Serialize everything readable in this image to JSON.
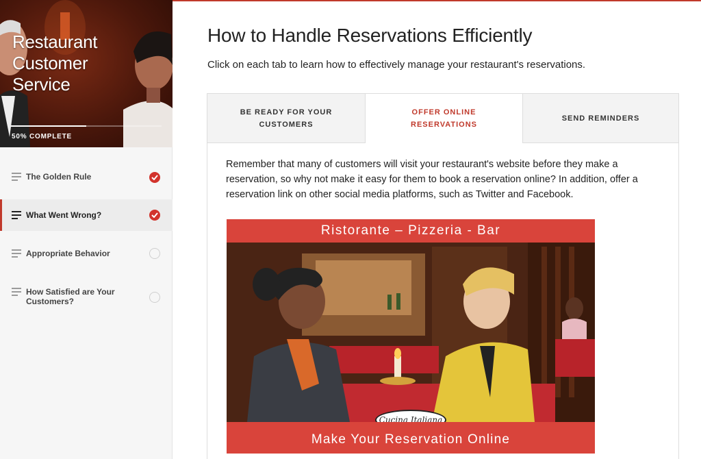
{
  "course": {
    "title": "Restaurant Customer Service",
    "progress_label": "50% COMPLETE",
    "progress_fraction": 0.5
  },
  "lessons": [
    {
      "label": "The Golden Rule",
      "status": "complete",
      "active": false,
      "icon": "lines-icon"
    },
    {
      "label": "What Went Wrong?",
      "status": "complete",
      "active": true,
      "icon": "lines-icon"
    },
    {
      "label": "Appropriate Behavior",
      "status": "incomplete",
      "active": false,
      "icon": "lines-icon"
    },
    {
      "label": "How Satisfied are Your Customers?",
      "status": "incomplete",
      "active": false,
      "icon": "lines-icon"
    }
  ],
  "page": {
    "title": "How to Handle Reservations Efficiently",
    "intro": "Click on each tab to learn how to effectively manage your restaurant's reservations."
  },
  "tabs": [
    {
      "label": "BE READY FOR YOUR CUSTOMERS",
      "selected": false
    },
    {
      "label": "OFFER ONLINE RESERVATIONS",
      "selected": true
    },
    {
      "label": "SEND REMINDERS",
      "selected": false
    }
  ],
  "tab_content": {
    "text": "Remember that many of customers will visit your restaurant's website before they make a reservation, so why not make it easy for them to book a reservation online? In addition, offer a reservation link on other social media platforms, such as Twitter and Facebook.",
    "image": {
      "banner_top": "Ristorante – Pizzeria - Bar",
      "logo": "Cucina Italiana",
      "banner_bottom": "Make Your Reservation Online"
    }
  },
  "colors": {
    "accent": "#c0392b",
    "banner": "#d9443b",
    "check": "#d2332c"
  }
}
